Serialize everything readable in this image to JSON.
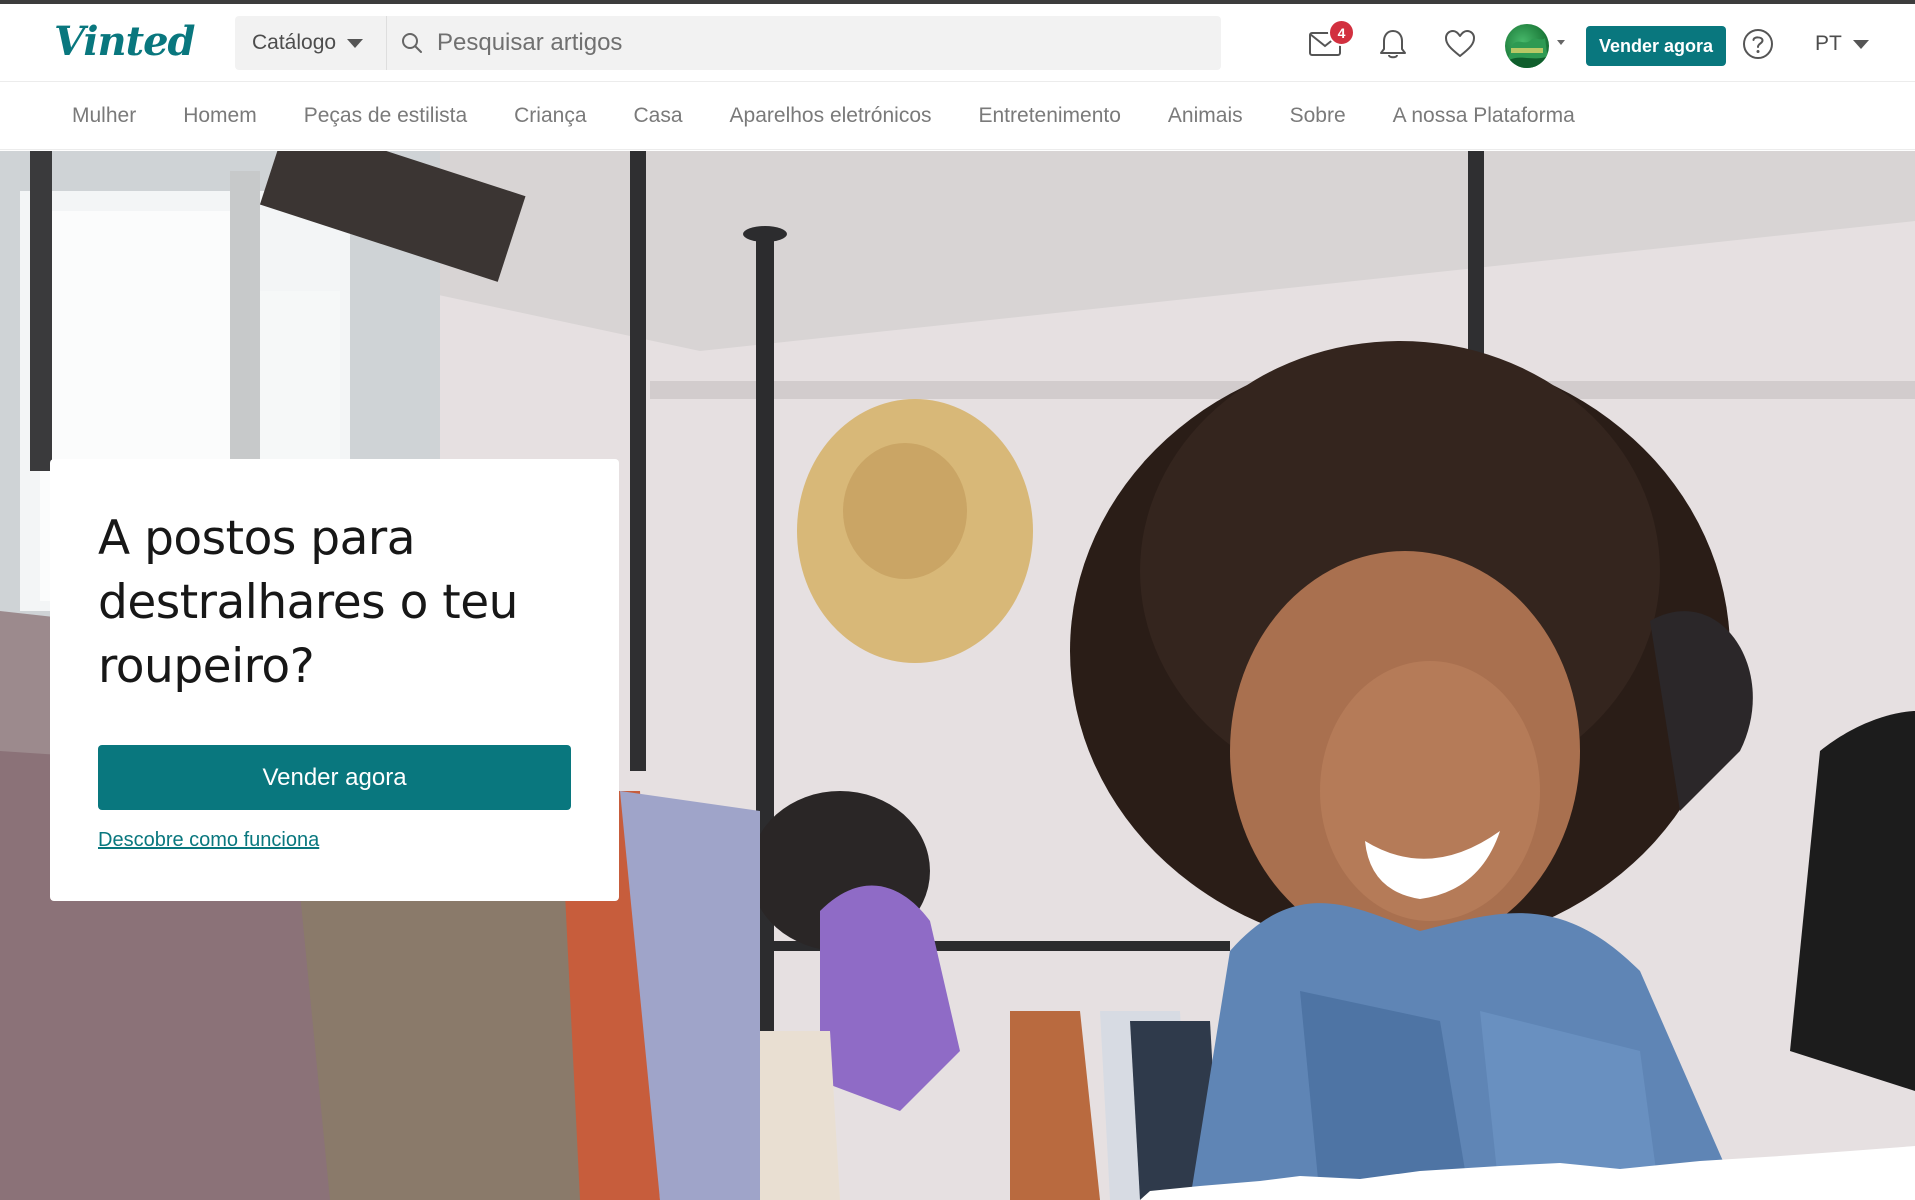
{
  "brand": {
    "logo_text": "Vinted",
    "accent": "#09777e"
  },
  "header": {
    "catalog_label": "Catálogo",
    "search_placeholder": "Pesquisar artigos",
    "mail_badge_count": "4",
    "sell_button_label": "Vender agora",
    "language": "PT",
    "icons": [
      "mail-icon",
      "bell-icon",
      "heart-icon",
      "help-icon"
    ]
  },
  "nav": {
    "items": [
      {
        "label": "Mulher"
      },
      {
        "label": "Homem"
      },
      {
        "label": "Peças de estilista"
      },
      {
        "label": "Criança"
      },
      {
        "label": "Casa"
      },
      {
        "label": "Aparelhos eletrónicos"
      },
      {
        "label": "Entretenimento"
      },
      {
        "label": "Animais"
      },
      {
        "label": "Sobre"
      },
      {
        "label": "A nossa Plataforma"
      }
    ]
  },
  "hero": {
    "title": "A postos para destralhares o teu roupeiro?",
    "cta_label": "Vender agora",
    "link_label": "Descobre como funciona"
  }
}
